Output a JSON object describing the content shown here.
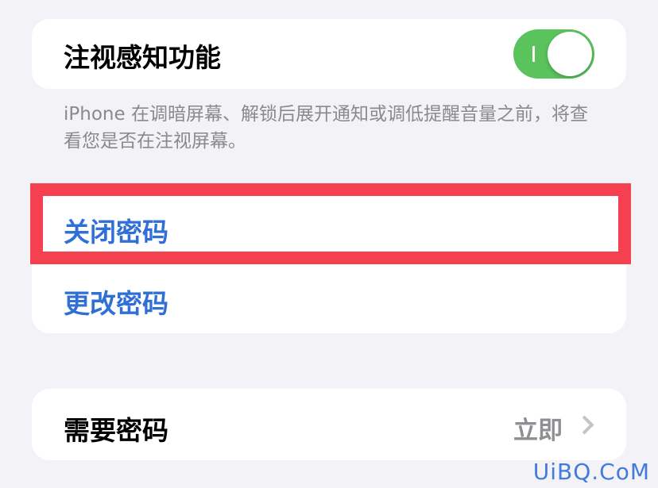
{
  "attention": {
    "label": "注视感知功能",
    "toggle_on": true,
    "toggle_color": "#5ac35c",
    "footnote": "iPhone 在调暗屏幕、解锁后展开通知或调低提醒音量之前，将查看您是否在注视屏幕。"
  },
  "passcode": {
    "turn_off_label": "关闭密码",
    "change_label": "更改密码",
    "link_color": "#2f6fd6",
    "highlight_color": "#f4404f"
  },
  "require": {
    "label": "需要密码",
    "value": "立即"
  },
  "watermark": "UiBQ.CoM"
}
